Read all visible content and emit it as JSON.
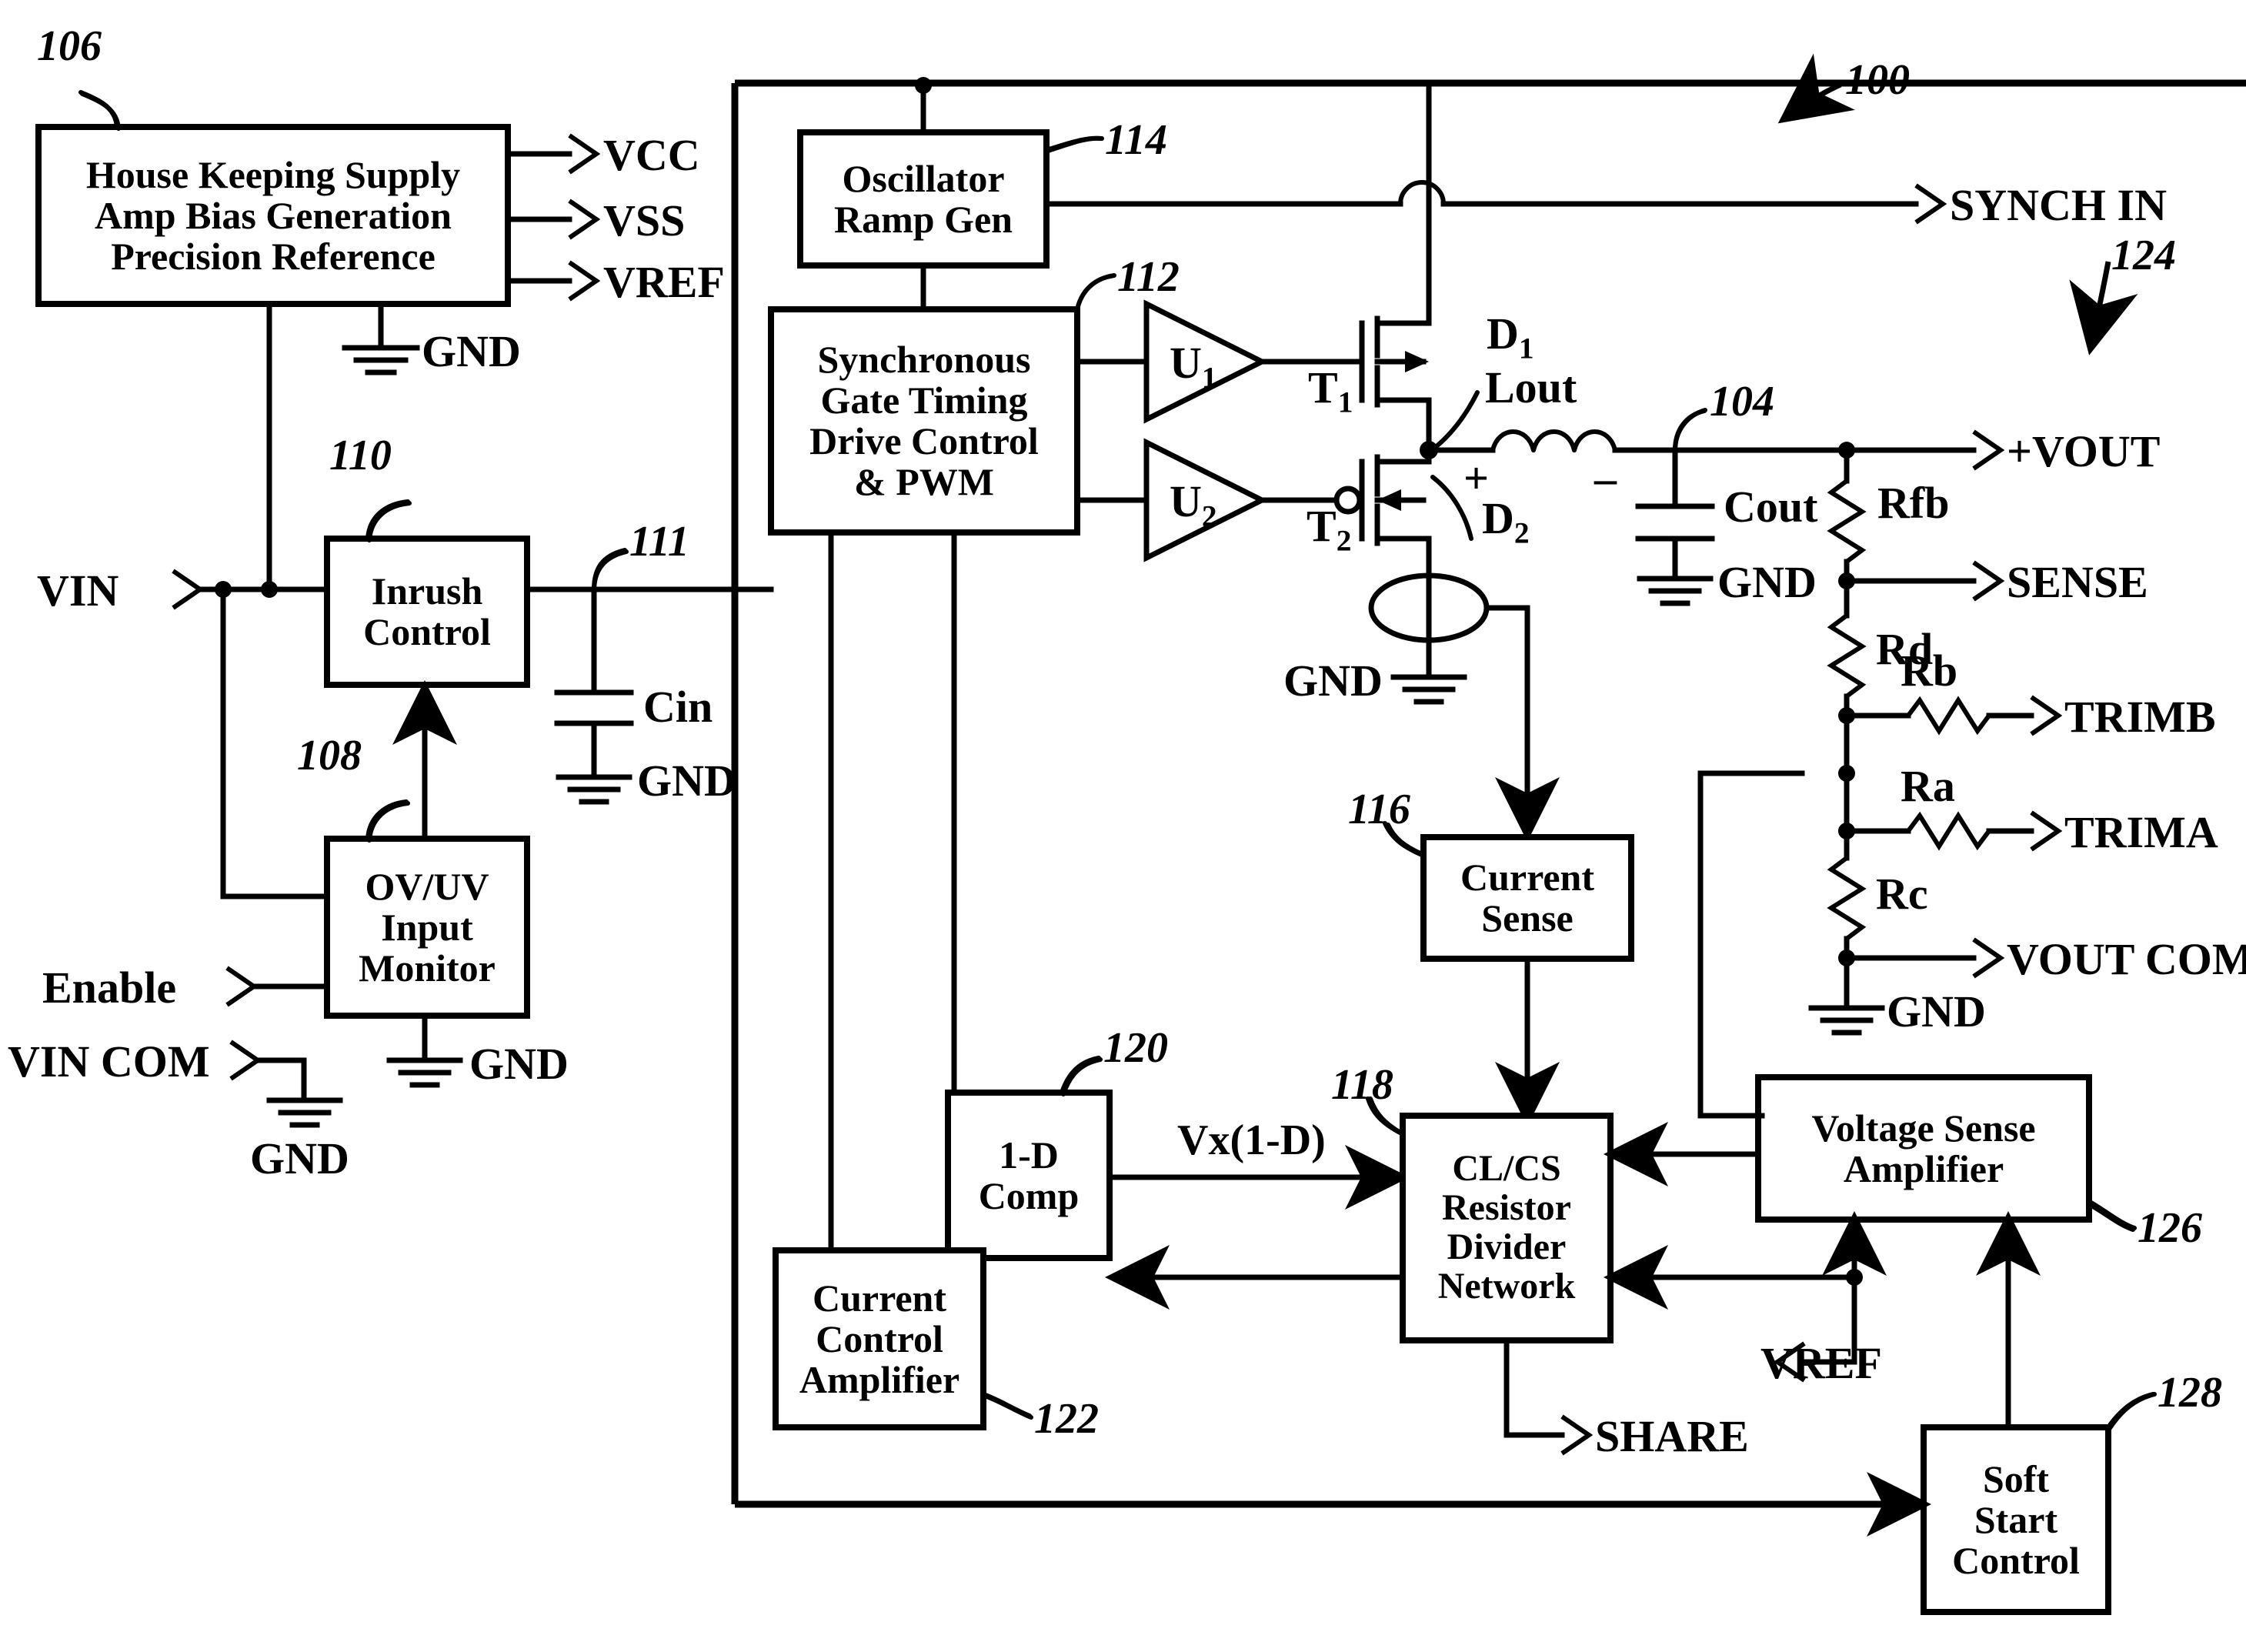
{
  "figure": {
    "type": "patent-block-diagram",
    "overall_ref": "100",
    "title_absent": true
  },
  "blocks": [
    {
      "id": "housekeeping",
      "ref": "106",
      "lines": [
        "House Keeping Supply",
        "Amp Bias Generation",
        "Precision Reference"
      ]
    },
    {
      "id": "inrush",
      "ref": "110",
      "lines": [
        "Inrush",
        "Control"
      ]
    },
    {
      "id": "ovuv",
      "ref": "108",
      "lines": [
        "OV/UV",
        "Input",
        "Monitor"
      ]
    },
    {
      "id": "oscillator",
      "ref": "114",
      "lines": [
        "Oscillator",
        "Ramp Gen"
      ]
    },
    {
      "id": "gatetiming",
      "ref": "112",
      "lines": [
        "Synchronous",
        "Gate Timing",
        "Drive Control",
        "& PWM"
      ]
    },
    {
      "id": "currentsense",
      "ref": "116",
      "lines": [
        "Current",
        "Sense"
      ]
    },
    {
      "id": "onedcomp",
      "ref": "120",
      "lines": [
        "1-D",
        "Comp"
      ]
    },
    {
      "id": "clcs",
      "ref": "118",
      "lines": [
        "CL/CS",
        "Resistor",
        "Divider",
        "Network"
      ]
    },
    {
      "id": "currentctrlamp",
      "ref": "122",
      "lines": [
        "Current",
        "Control",
        "Amplifier"
      ]
    },
    {
      "id": "voltagesenseamp",
      "ref": "126",
      "lines": [
        "Voltage Sense",
        "Amplifier"
      ]
    },
    {
      "id": "softstart",
      "ref": "128",
      "lines": [
        "Soft",
        "Start",
        "Control"
      ]
    }
  ],
  "ref_numbers": {
    "overall": "100",
    "housekeeping": "106",
    "inrush": "110",
    "ovuv": "108",
    "node111": "111",
    "gatetiming": "112",
    "oscillator": "114",
    "currentsense": "116",
    "clcs": "118",
    "onedcomp": "120",
    "currentctrlamp": "122",
    "outnode104": "104",
    "outsection124": "124",
    "voltagesenseamp": "126",
    "softstart": "128"
  },
  "pins": {
    "vcc": "VCC",
    "vss": "VSS",
    "vref_top": "VREF",
    "synch_in": "SYNCH IN",
    "vout": "+VOUT",
    "sense": "SENSE",
    "trimb": "TRIMB",
    "trima": "TRIMA",
    "vout_com": "VOUT COM",
    "vin": "VIN",
    "enable": "Enable",
    "vin_com": "VIN COM",
    "share": "SHARE",
    "vref_bottom": "VREF"
  },
  "components": {
    "cin": "Cin",
    "cout": "Cout",
    "lout": "Lout",
    "rfb": "Rfb",
    "rd": "Rd",
    "rb": "Rb",
    "ra": "Ra",
    "rc": "Rc",
    "t1": "T",
    "t1_sub": "1",
    "t2": "T",
    "t2_sub": "2",
    "u1": "U",
    "u1_sub": "1",
    "u2": "U",
    "u2_sub": "2",
    "d1": "D",
    "d1_sub": "1",
    "d2": "D",
    "d2_sub": "2"
  },
  "ground_labels": {
    "gnd_housekeeping": "GND",
    "gnd_cin": "GND",
    "gnd_ovuv": "GND",
    "gnd_vincom": "GND",
    "gnd_cout": "GND",
    "gnd_power": "GND",
    "gnd_xfmr": "GND",
    "gnd_divider": "GND"
  },
  "signal_labels": {
    "vx_1_minus_d": "Vx(1-D)",
    "polarity_plus": "+",
    "polarity_minus": "–"
  },
  "colors": {
    "line": "#000000",
    "background": "#ffffff",
    "text": "#000000"
  }
}
